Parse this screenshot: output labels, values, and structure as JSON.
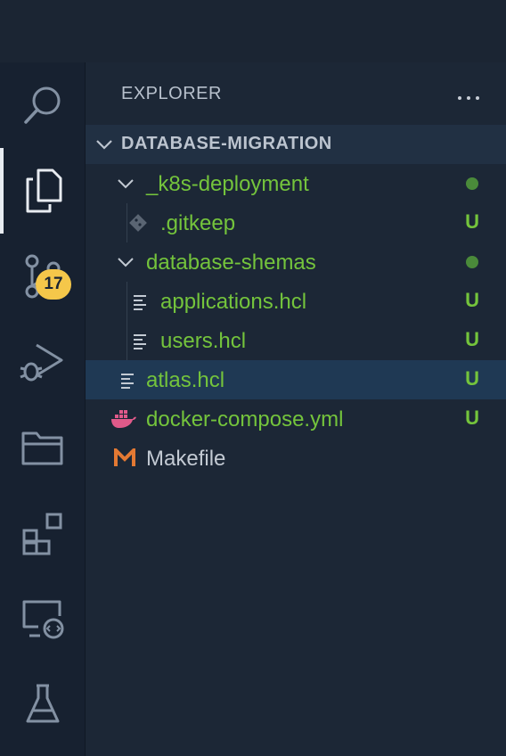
{
  "activity_bar": {
    "items": [
      {
        "icon": "search-icon"
      },
      {
        "icon": "explorer-files-icon",
        "active": true
      },
      {
        "icon": "source-control-icon",
        "badge": "17"
      },
      {
        "icon": "run-debug-icon"
      },
      {
        "icon": "folder-icon"
      },
      {
        "icon": "extensions-icon"
      },
      {
        "icon": "remote-explorer-icon"
      },
      {
        "icon": "testing-flask-icon"
      }
    ]
  },
  "sidebar": {
    "title": "EXPLORER",
    "more_actions": "...",
    "section_title": "DATABASE-MIGRATION",
    "tree": [
      {
        "label": "_k8s-deployment",
        "type": "folder",
        "status": "dot"
      },
      {
        "label": ".gitkeep",
        "type": "git-file",
        "status": "U"
      },
      {
        "label": "database-shemas",
        "type": "folder",
        "status": "dot"
      },
      {
        "label": "applications.hcl",
        "type": "text-file",
        "status": "U"
      },
      {
        "label": "users.hcl",
        "type": "text-file",
        "status": "U"
      },
      {
        "label": "atlas.hcl",
        "type": "text-file",
        "status": "U",
        "selected": true
      },
      {
        "label": "docker-compose.yml",
        "type": "docker-file",
        "status": "U"
      },
      {
        "label": "Makefile",
        "type": "makefile",
        "status": ""
      }
    ]
  },
  "colors": {
    "untracked_green": "#74c43c",
    "selection": "#1f3954",
    "badge": "#f5c74a",
    "docker_pink": "#e05a8a",
    "makefile_orange": "#e37933"
  }
}
